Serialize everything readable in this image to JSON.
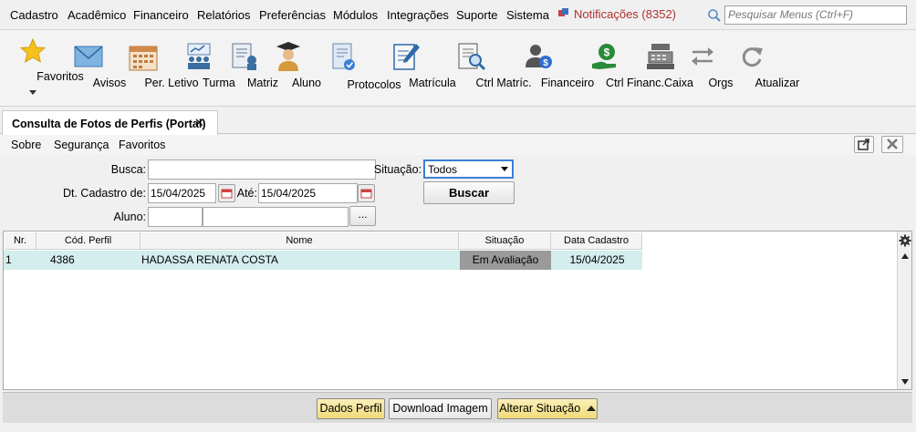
{
  "menu": {
    "items": [
      {
        "label": "Cadastro"
      },
      {
        "label": "Acadêmico"
      },
      {
        "label": "Financeiro"
      },
      {
        "label": "Relatórios"
      },
      {
        "label": "Preferências"
      },
      {
        "label": "Módulos"
      },
      {
        "label": "Integrações"
      },
      {
        "label": "Suporte"
      },
      {
        "label": "Sistema"
      }
    ],
    "notifications": "Notificações (8352)",
    "search_placeholder": "Pesquisar Menus (Ctrl+F)"
  },
  "toolbar": {
    "items": [
      {
        "label": "Favoritos",
        "icon": "star-icon"
      },
      {
        "label": "Avisos",
        "icon": "envelope-icon"
      },
      {
        "label": "Per. Letivo",
        "icon": "calendar-icon"
      },
      {
        "label": "Turma",
        "icon": "classroom-icon"
      },
      {
        "label": "Matriz",
        "icon": "matrix-icon"
      },
      {
        "label": "Aluno",
        "icon": "student-icon"
      },
      {
        "label": "Protocolos",
        "icon": "protocol-icon"
      },
      {
        "label": "Matrícula",
        "icon": "enrollment-icon"
      },
      {
        "label": "Ctrl Matríc.",
        "icon": "enrollment-control-icon"
      },
      {
        "label": "Financeiro",
        "icon": "finance-icon"
      },
      {
        "label": "Ctrl Financ.",
        "icon": "finance-control-icon"
      },
      {
        "label": "Caixa",
        "icon": "cash-register-icon"
      },
      {
        "label": "Orgs",
        "icon": "orgs-icon"
      },
      {
        "label": "Atualizar",
        "icon": "refresh-icon"
      }
    ]
  },
  "tab": {
    "title": "Consulta de Fotos de Perfis (Portal)",
    "close": "✕"
  },
  "submenu": {
    "items": [
      {
        "label": "Sobre"
      },
      {
        "label": "Segurança"
      },
      {
        "label": "Favoritos"
      }
    ]
  },
  "form": {
    "busca_label": "Busca:",
    "busca_value": "",
    "situacao_label": "Situação:",
    "situacao_value": "Todos",
    "dt_cadastro_label": "Dt. Cadastro de:",
    "dt_from": "15/04/2025",
    "ate_label": "Até:",
    "dt_to": "15/04/2025",
    "buscar_button": "Buscar",
    "aluno_label": "Aluno:",
    "aluno_code": "",
    "aluno_name": "",
    "dots_button": "..."
  },
  "grid": {
    "columns": [
      "Nr.",
      "Cód. Perfil",
      "Nome",
      "Situação",
      "Data Cadastro"
    ],
    "rows": [
      {
        "nr": "1",
        "cod_perfil": "4386",
        "nome": "HADASSA RENATA COSTA",
        "situacao": "Em Avaliação",
        "data_cadastro": "15/04/2025"
      }
    ]
  },
  "actions": {
    "dados_perfil": "Dados Perfil",
    "download_imagem": "Download Imagem",
    "alterar_situacao": "Alterar Situação"
  },
  "colors": {
    "row_highlight": "#d4eded",
    "status_cell": "#9a9a9a",
    "action_yellow": "#f0da7a",
    "notification_red": "#b03030",
    "select_border": "#3c7fd4"
  }
}
